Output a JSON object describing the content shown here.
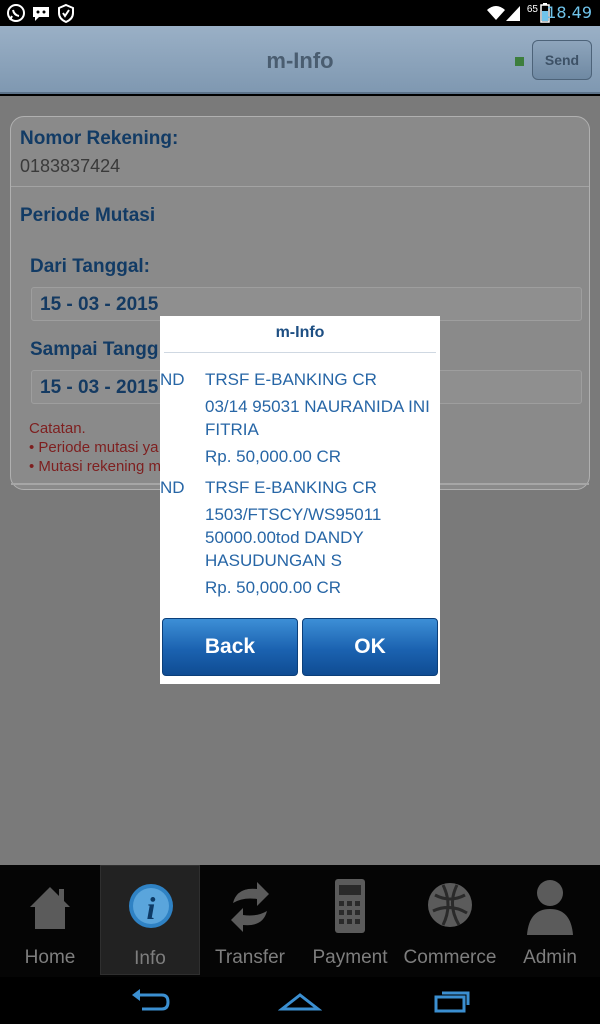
{
  "status_bar": {
    "time": "18.49",
    "battery_level": "65",
    "left_icons": [
      "whatsapp-icon",
      "chat-bubble-icon",
      "shield-icon"
    ]
  },
  "header": {
    "title": "m-Info",
    "send_label": "Send"
  },
  "form": {
    "account_label": "Nomor Rekening:",
    "account_value": "0183837424",
    "period_label": "Periode Mutasi",
    "from_label": "Dari Tanggal:",
    "from_value": "15 - 03 - 2015",
    "to_label": "Sampai Tangg",
    "to_value": "15 - 03 - 2015",
    "note_title": "Catatan.",
    "note_line1": "• Periode mutasi ya",
    "note_line2": "• Mutasi rekening m"
  },
  "dialog": {
    "title": "m-Info",
    "entries": [
      {
        "code": "ND",
        "type": "TRSF E-BANKING CR",
        "desc_line1": "03/14 95031 NAURANIDA INI",
        "desc_line2": "FITRIA",
        "amount": "Rp. 50,000.00 CR"
      },
      {
        "code": "ND",
        "type": "TRSF E-BANKING CR",
        "desc_line1": "1503/FTSCY/WS95011",
        "desc_line2": "50000.00tod DANDY",
        "desc_line3": "HASUDUNGAN S",
        "amount": "Rp. 50,000.00 CR"
      }
    ],
    "back_label": "Back",
    "ok_label": "OK"
  },
  "tabs": [
    {
      "label": "Home",
      "icon": "home-icon",
      "active": false
    },
    {
      "label": "Info",
      "icon": "info-icon",
      "active": true
    },
    {
      "label": "Transfer",
      "icon": "transfer-icon",
      "active": false
    },
    {
      "label": "Payment",
      "icon": "calculator-icon",
      "active": false
    },
    {
      "label": "Commerce",
      "icon": "globe-icon",
      "active": false
    },
    {
      "label": "Admin",
      "icon": "user-icon",
      "active": false
    }
  ],
  "nav": [
    "back-icon",
    "home-outline-icon",
    "recents-icon"
  ],
  "colors": {
    "accent": "#1b62b0",
    "label_blue": "#123b65",
    "status_time": "#6fc3ea",
    "note_red": "#7e1f1f"
  }
}
